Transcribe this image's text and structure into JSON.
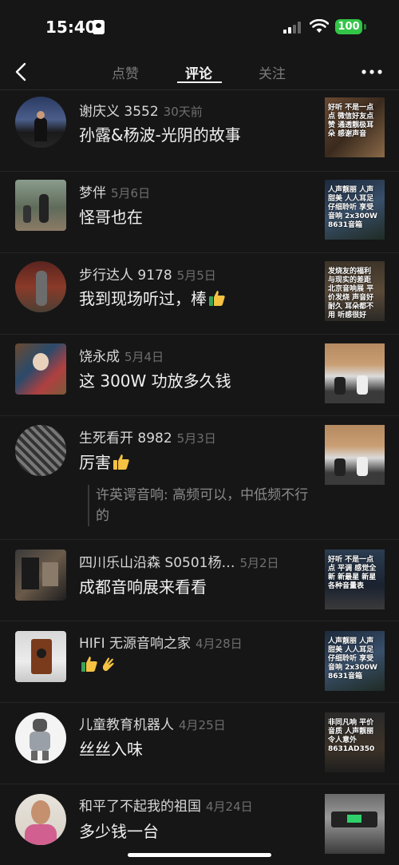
{
  "status": {
    "time": "15:40",
    "battery": "100"
  },
  "nav": {
    "tabs": [
      "点赞",
      "评论",
      "关注"
    ],
    "active_tab": "评论"
  },
  "comments": [
    {
      "name": "谢庆义 3552",
      "time": "30天前",
      "text": "孙露&杨波-光阴的故事",
      "thumb_text": "好听 不是一点点 微信好友点赞 通透靓极耳朵 感谢声音"
    },
    {
      "name": "梦伴",
      "time": "5月6日",
      "text": "怪哥也在",
      "thumb_text": "人声靓丽 人声甜美 人人耳足 仔细聆听 享受音响 2x300W 8631音箱"
    },
    {
      "name": "步行达人 9178",
      "time": "5月5日",
      "text": "我到现场听过，棒",
      "thumb_text": "发烧友的福利 与现实的差距 北京音响展 平价发烧 声音好耐久 耳朵都不用 听感很好"
    },
    {
      "name": "饶永成",
      "time": "5月4日",
      "text": "这 300W 功放多久钱",
      "thumb_text": ""
    },
    {
      "name": "生死看开 8982",
      "time": "5月3日",
      "text": "厉害",
      "reply": "许英谔音响: 高频可以，中低频不行的",
      "thumb_text": ""
    },
    {
      "name": "四川乐山沿森 S0501杨…",
      "time": "5月2日",
      "text": "成都音响展来看看",
      "thumb_text": "好听 不是一点点 平调 感觉全新 新最星 新星 各种音量表"
    },
    {
      "name": "HIFI 无源音响之家",
      "time": "4月28日",
      "text": "",
      "thumb_text": "人声靓丽 人声甜美 人人耳足 仔细聆听 享受音响 2x300W 8631音箱"
    },
    {
      "name": "儿童教育机器人",
      "time": "4月25日",
      "text": "丝丝入味",
      "thumb_text": "非同凡响 平价音质 人声靓丽 令人意外 8631AD350"
    },
    {
      "name": "和平了不起我的祖国",
      "time": "4月24日",
      "text": "多少钱一台",
      "thumb_text": ""
    }
  ],
  "colors": {
    "background": "#161616",
    "battery": "#33c548",
    "muted": "#6e6e6e"
  },
  "icons": [
    "back-icon",
    "more-icon",
    "thumbs-up-icon",
    "clap-icon",
    "signal-icon",
    "wifi-icon",
    "battery-icon",
    "id-card-icon"
  ]
}
